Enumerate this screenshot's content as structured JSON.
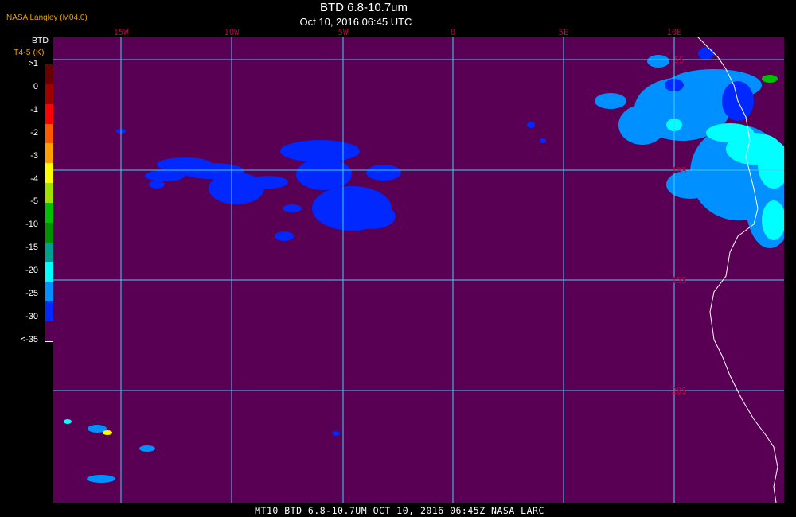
{
  "header": {
    "title": "BTD 6.8-10.7um",
    "subtitle": "Oct 10, 2016 06:45 UTC",
    "organization": "NASA Langley (M04.0)"
  },
  "legend": {
    "title_line1": "BTD",
    "title_line2": "T4-5 (K)",
    "ticks": [
      ">1",
      "0",
      "-1",
      "-2",
      "-3",
      "-4",
      "-5",
      "-10",
      "-15",
      "-20",
      "-25",
      "-30",
      "<-35"
    ],
    "colors": [
      "#6b0000",
      "#a00000",
      "#ff0000",
      "#ff5a00",
      "#ffa000",
      "#ffff00",
      "#a0e000",
      "#00c000",
      "#009000",
      "#00a090",
      "#00ffff",
      "#0090ff",
      "#0028ff",
      "#5a0054"
    ]
  },
  "map": {
    "background_color": "#5a0054",
    "grid_color": "#40d0f0",
    "label_color": "#c0004a",
    "lon_labels": [
      "15W",
      "10W",
      "5W",
      "0",
      "5E",
      "10E"
    ],
    "lat_labels": [
      "5S",
      "10S",
      "15S",
      "20S"
    ],
    "coastline_color": "#ffffff"
  },
  "footer": {
    "text": "MT10  BTD 6.8-10.7UM   OCT 10, 2016 06:45Z   NASA LARC"
  }
}
